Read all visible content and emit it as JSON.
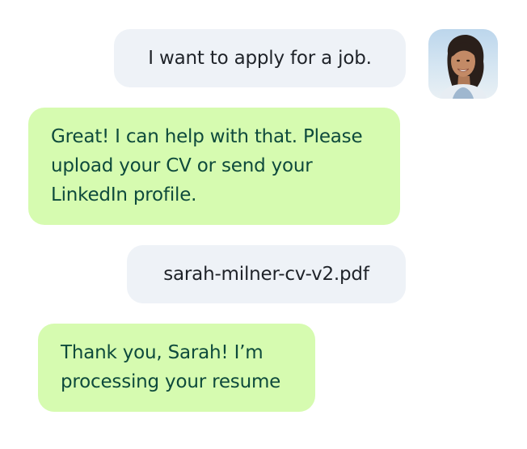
{
  "chat": {
    "messages": [
      {
        "sender": "user",
        "lines": [
          "I want to apply for a job."
        ]
      },
      {
        "sender": "assistant",
        "lines": [
          "Great! I can help with that. Please",
          "upload your CV or send your",
          "LinkedIn profile."
        ]
      },
      {
        "sender": "user",
        "lines": [
          "sarah-milner-cv-v2.pdf"
        ]
      },
      {
        "sender": "assistant",
        "lines": [
          "Thank you, Sarah! I’m",
          "processing your resume"
        ]
      }
    ]
  },
  "colors": {
    "user_bubble": "#eef2f7",
    "user_text": "#1f2329",
    "assistant_bubble": "#d6fbb0",
    "assistant_text": "#0e4a3c"
  }
}
